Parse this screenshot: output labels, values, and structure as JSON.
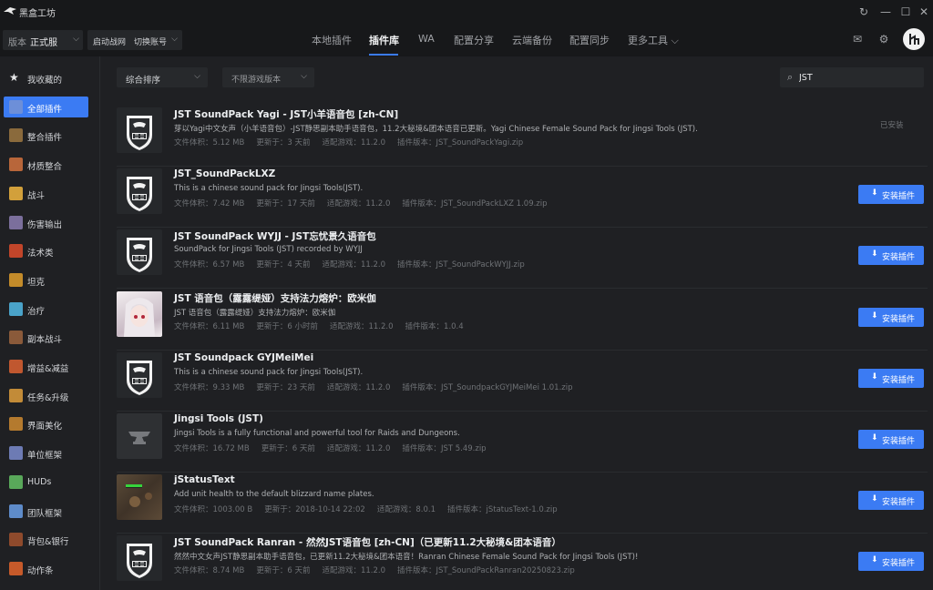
{
  "app": {
    "title": "黑盒工坊"
  },
  "toolbar": {
    "version_label": "版本",
    "version_value": "正式服",
    "launch_label": "启动战网",
    "switch_account": "切换账号"
  },
  "tabs": [
    {
      "label": "本地插件",
      "active": false
    },
    {
      "label": "插件库",
      "active": true
    },
    {
      "label": "WA",
      "active": false
    },
    {
      "label": "配置分享",
      "active": false
    },
    {
      "label": "云端备份",
      "active": false
    },
    {
      "label": "配置同步",
      "active": false
    },
    {
      "label": "更多工具",
      "active": false
    }
  ],
  "sidebar": {
    "items": [
      {
        "label": "我收藏的",
        "icon": "star-icon"
      },
      {
        "label": "全部插件",
        "icon": "all-addons-icon",
        "active": true
      },
      {
        "label": "整合插件",
        "icon": "bundle-icon"
      },
      {
        "label": "材质整合",
        "icon": "texture-icon"
      },
      {
        "label": "战斗",
        "icon": "combat-icon"
      },
      {
        "label": "伤害输出",
        "icon": "damage-icon"
      },
      {
        "label": "法术类",
        "icon": "spell-icon"
      },
      {
        "label": "坦克",
        "icon": "tank-icon"
      },
      {
        "label": "治疗",
        "icon": "healing-icon"
      },
      {
        "label": "副本战斗",
        "icon": "dungeon-icon"
      },
      {
        "label": "增益&减益",
        "icon": "buff-icon"
      },
      {
        "label": "任务&升级",
        "icon": "quest-icon"
      },
      {
        "label": "界面美化",
        "icon": "ui-icon"
      },
      {
        "label": "单位框架",
        "icon": "unit-frame-icon"
      },
      {
        "label": "HUDs",
        "icon": "hud-icon"
      },
      {
        "label": "团队框架",
        "icon": "raid-frame-icon"
      },
      {
        "label": "背包&银行",
        "icon": "bag-icon"
      },
      {
        "label": "动作条",
        "icon": "action-bar-icon"
      }
    ]
  },
  "filters": {
    "sort": "综合排序",
    "game_version": "不限游戏版本",
    "search_value": "JST"
  },
  "meta_labels": {
    "size": "文件体积：",
    "updated": "更新于：",
    "game": "适配游戏：",
    "version": "插件版本："
  },
  "install_label": "安装插件",
  "installed_label": "已安装",
  "colors": {
    "accent": "#3b7bf3",
    "background": "#1f2023",
    "titlebar": "#17181a"
  },
  "plugins": [
    {
      "title": "JST SoundPack Yagi - JST小羊语音包 [zh-CN]",
      "desc": "芽以Yagi中文女声（小羊语音包）-JST静思副本助手语音包，11.2大秘境&团本语音已更新。Yagi Chinese Female Sound Pack for Jingsi Tools (JST).",
      "size": "5.12 MB",
      "updated": "3 天前",
      "game": "11.2.0",
      "version": "JST_SoundPackYagi.zip",
      "installed": true,
      "thumb": "shield"
    },
    {
      "title": "JST_SoundPackLXZ",
      "desc": "This is a chinese sound pack for Jingsi Tools(JST).",
      "size": "7.42 MB",
      "updated": "17 天前",
      "game": "11.2.0",
      "version": "JST_SoundPackLXZ 1.09.zip",
      "installed": false,
      "thumb": "shield"
    },
    {
      "title": "JST SoundPack WYJJ - JST忘忧景久语音包",
      "desc": "SoundPack for Jingsi Tools (JST) recorded by WYJJ",
      "size": "6.57 MB",
      "updated": "4 天前",
      "game": "11.2.0",
      "version": "JST_SoundPackWYJJ.zip",
      "installed": false,
      "thumb": "shield"
    },
    {
      "title": "JST 语音包（露露缇娅）支持法力熔炉：欧米伽",
      "desc": "JST 语音包（露露缇娅）支持法力熔炉：欧米伽",
      "size": "6.11 MB",
      "updated": "6 小时前",
      "game": "11.2.0",
      "version": "1.0.4",
      "installed": false,
      "thumb": "anime"
    },
    {
      "title": "JST Soundpack GYJMeiMei",
      "desc": "This is a chinese sound pack for Jingsi Tools(JST).",
      "size": "9.33 MB",
      "updated": "23 天前",
      "game": "11.2.0",
      "version": "JST_SoundpackGYJMeiMei 1.01.zip",
      "installed": false,
      "thumb": "shield"
    },
    {
      "title": "Jingsi Tools (JST)",
      "desc": "Jingsi Tools is a fully functional and powerful tool for Raids and Dungeons.",
      "size": "16.72 MB",
      "updated": "6 天前",
      "game": "11.2.0",
      "version": "JST 5.49.zip",
      "installed": false,
      "thumb": "dark"
    },
    {
      "title": "jStatusText",
      "desc": "Add unit health to the default blizzard name plates.",
      "size": "1003.00 B",
      "updated": "2018-10-14 22:02",
      "game": "8.0.1",
      "version": "jStatusText-1.0.zip",
      "installed": false,
      "thumb": "game"
    },
    {
      "title": "JST SoundPack Ranran - 然然JST语音包 [zh-CN]（已更新11.2大秘境&团本语音）",
      "desc": "然然中文女声JST静思副本助手语音包，已更新11.2大秘境&团本语音！Ranran Chinese Female Sound Pack for Jingsi Tools (JST)!",
      "size": "8.74 MB",
      "updated": "6 天前",
      "game": "11.2.0",
      "version": "JST_SoundPackRanran20250823.zip",
      "installed": false,
      "thumb": "shield"
    }
  ]
}
